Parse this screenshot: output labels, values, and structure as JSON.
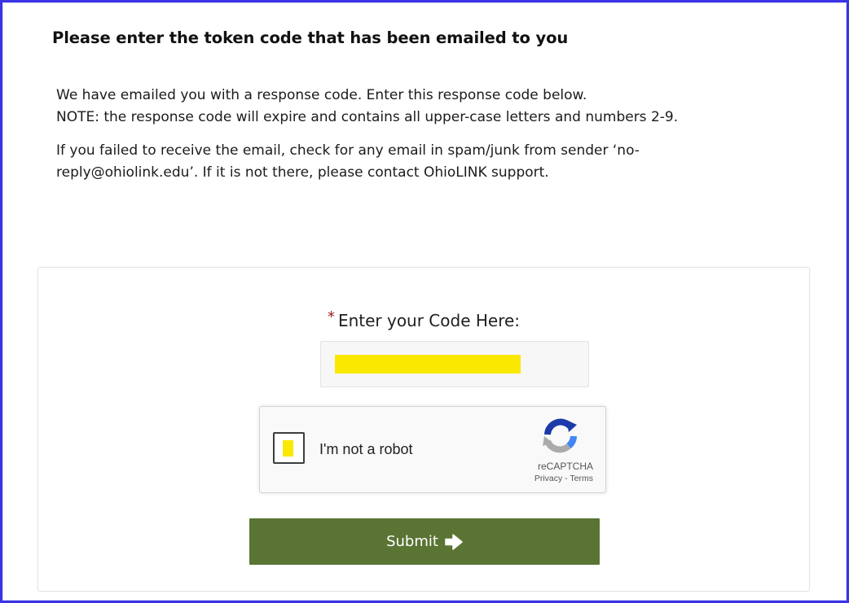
{
  "page": {
    "heading": "Please enter the token code that has been emailed to you",
    "instructions": {
      "line1": "We have emailed you with a response code. Enter this response code below.",
      "line2": "NOTE: the response code will expire and contains all upper-case letters and numbers 2-9.",
      "line3": "If you failed to receive the email, check for any email in spam/junk from sender ‘no-",
      "line4": "reply@ohiolink.edu’. If it is not there, please contact OhioLINK support."
    }
  },
  "form": {
    "required_marker": "*",
    "code_label": "Enter your Code Here:",
    "code_value": "",
    "code_placeholder": ""
  },
  "recaptcha": {
    "label": "I'm not a robot",
    "brand": "reCAPTCHA",
    "privacy_link": "Privacy",
    "separator": " - ",
    "terms_link": "Terms",
    "checkbox_icon": "checkbox-icon",
    "logo_icon": "recaptcha-logo-icon"
  },
  "submit": {
    "label": "Submit",
    "icon": "arrow-right-icon",
    "color": "#5a7434"
  },
  "colors": {
    "frame_border": "#3a34e6",
    "required_star": "#9b1b1b",
    "redaction": "#fae800"
  }
}
